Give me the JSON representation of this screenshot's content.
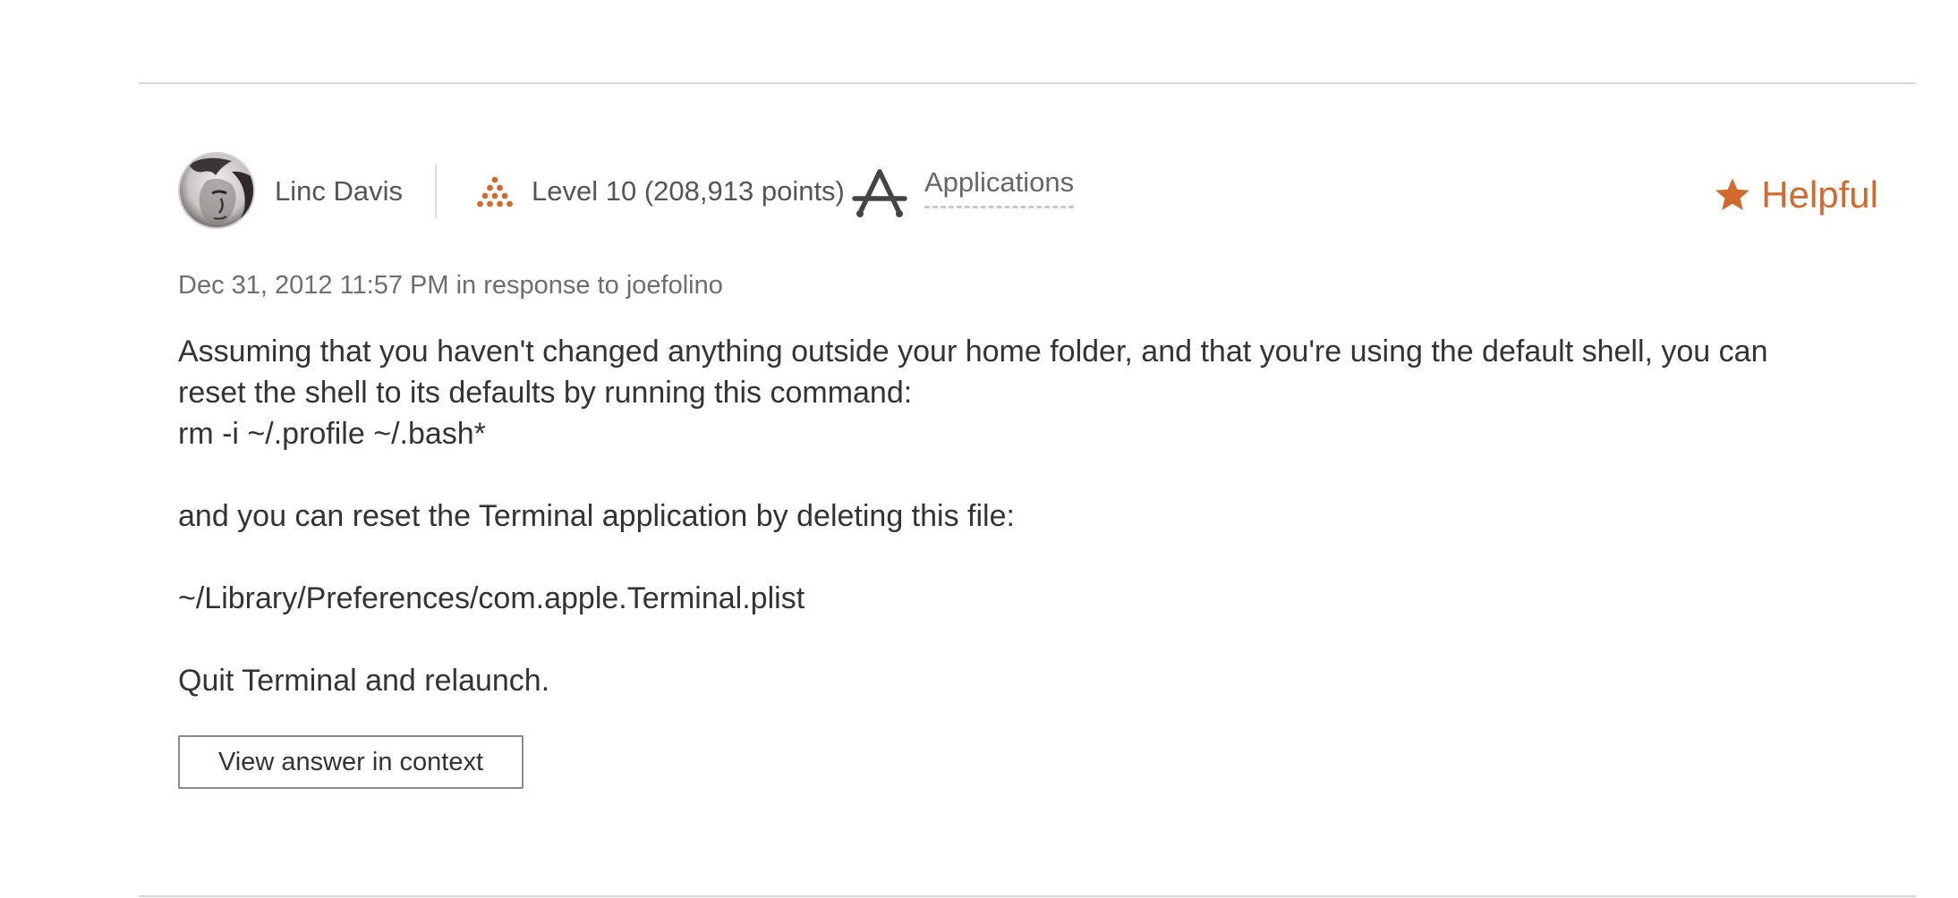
{
  "post": {
    "author": {
      "name": "Linc Davis",
      "avatar_icon": "user-avatar",
      "level": "Level 10",
      "points": "(208,913 points)",
      "level_icon": "level-pyramid-icon",
      "community": "Applications",
      "community_icon": "app-store-icon"
    },
    "helpful": {
      "label": "Helpful",
      "icon": "star-icon",
      "color": "#d26a2e"
    },
    "meta": "Dec 31, 2012 11:57 PM in response to joefolino",
    "body": {
      "line1": "Assuming that you haven't changed anything outside your home folder, and that you're using the default shell, you can reset the shell to its defaults by running this command:",
      "line2": "rm -i ~/.profile ~/.bash*",
      "line3": "and you can reset the Terminal application by deleting this file:",
      "line4": "~/Library/Preferences/com.apple.Terminal.plist",
      "line5": "Quit Terminal and relaunch."
    },
    "context_button": "View answer in context"
  }
}
